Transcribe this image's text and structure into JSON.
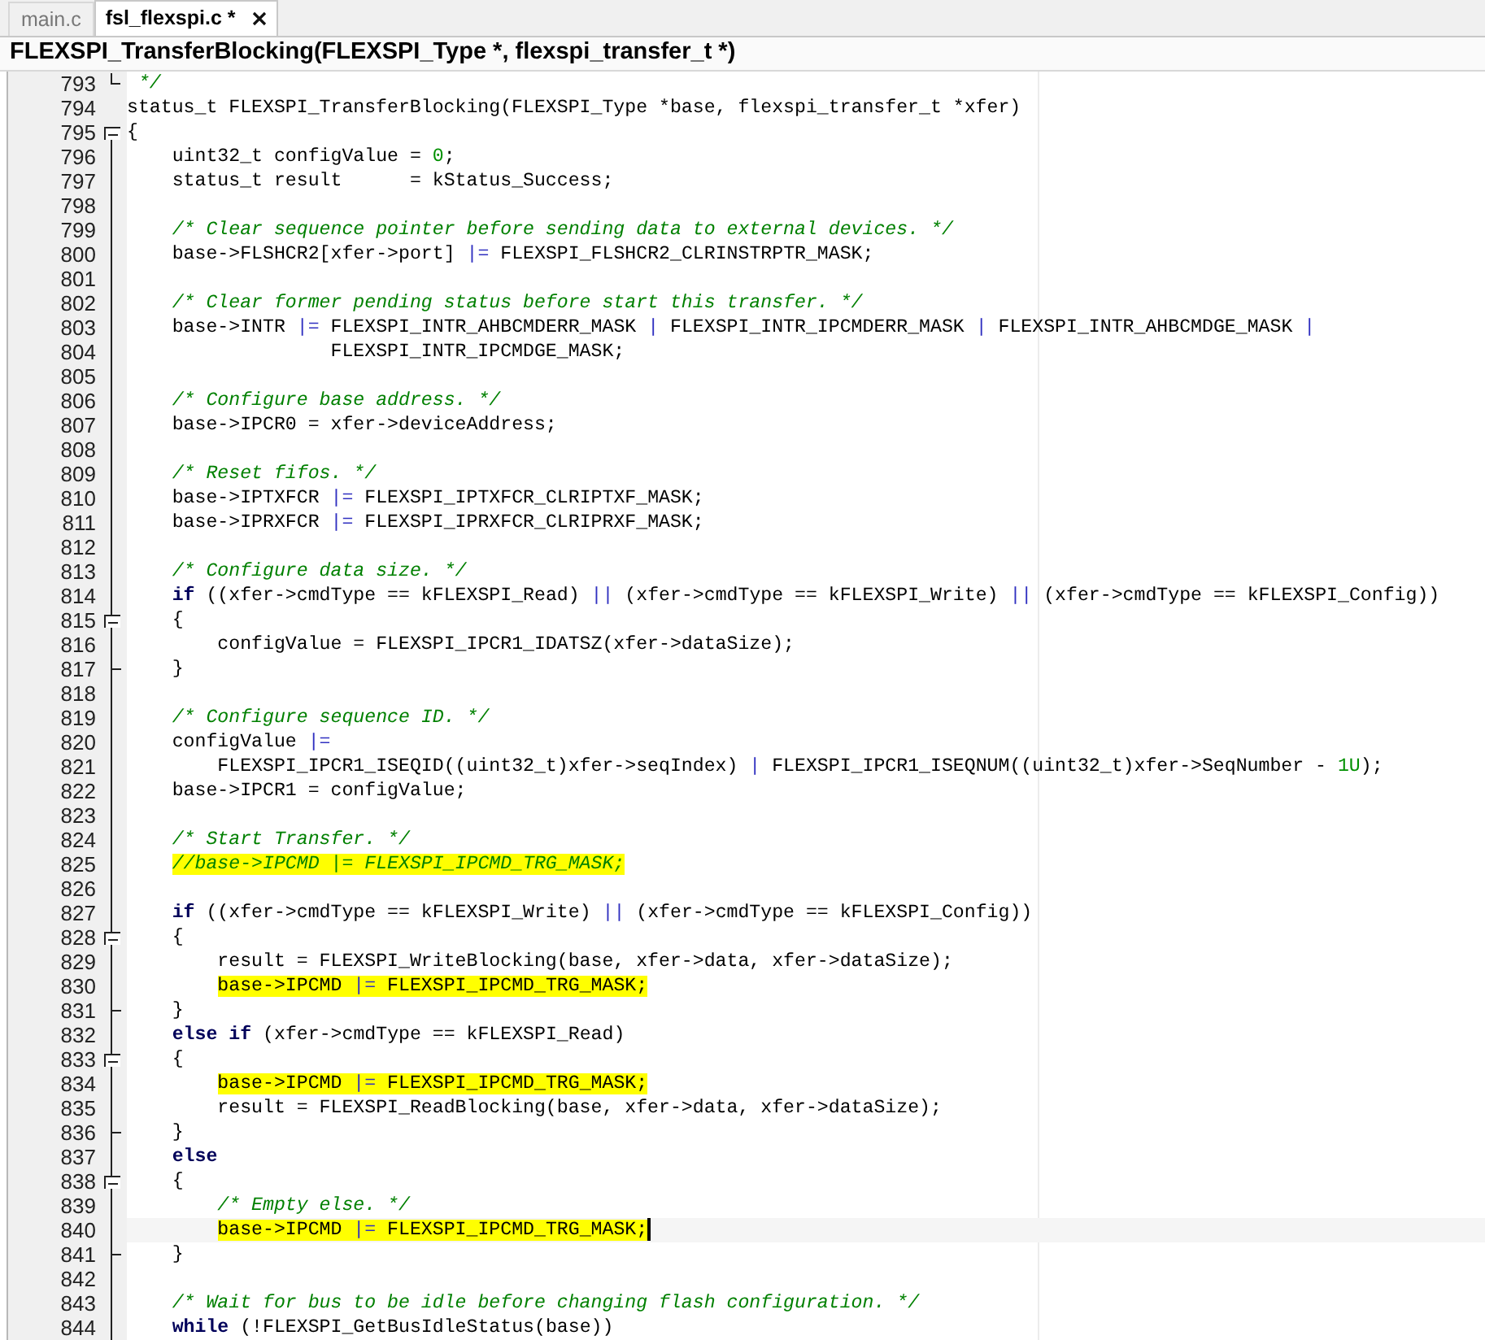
{
  "tabs": [
    {
      "label": "main.c",
      "selected": false,
      "closable": false
    },
    {
      "label": "fsl_flexspi.c *",
      "selected": true,
      "closable": true
    }
  ],
  "function_bar": {
    "title": "FLEXSPI_TransferBlocking(FLEXSPI_Type *, flexspi_transfer_t *)"
  },
  "lines": [
    {
      "n": "793",
      "kind": "comment",
      "text": " */",
      "fold_end": true
    },
    {
      "n": "794",
      "kind": "code",
      "text": "status_t FLEXSPI_TransferBlocking(FLEXSPI_Type *base, flexspi_transfer_t *xfer)"
    },
    {
      "n": "795",
      "kind": "code",
      "text": "{",
      "fold_open": true
    },
    {
      "n": "796",
      "kind": "code",
      "text": "    uint32_t configValue = 0;"
    },
    {
      "n": "797",
      "kind": "code",
      "text": "    status_t result      = kStatus_Success;"
    },
    {
      "n": "798"
    },
    {
      "n": "799",
      "kind": "comment",
      "text": "    /* Clear sequence pointer before sending data to external devices. */"
    },
    {
      "n": "800",
      "kind": "code",
      "text": "    base->FLSHCR2[xfer->port] |= FLEXSPI_FLSHCR2_CLRINSTRPTR_MASK;"
    },
    {
      "n": "801"
    },
    {
      "n": "802",
      "kind": "comment",
      "text": "    /* Clear former pending status before start this transfer. */"
    },
    {
      "n": "803",
      "kind": "code",
      "text": "    base->INTR |= FLEXSPI_INTR_AHBCMDERR_MASK | FLEXSPI_INTR_IPCMDERR_MASK | FLEXSPI_INTR_AHBCMDGE_MASK |"
    },
    {
      "n": "804",
      "kind": "code",
      "text": "                  FLEXSPI_INTR_IPCMDGE_MASK;"
    },
    {
      "n": "805"
    },
    {
      "n": "806",
      "kind": "comment",
      "text": "    /* Configure base address. */"
    },
    {
      "n": "807",
      "kind": "code",
      "text": "    base->IPCR0 = xfer->deviceAddress;"
    },
    {
      "n": "808"
    },
    {
      "n": "809",
      "kind": "comment",
      "text": "    /* Reset fifos. */"
    },
    {
      "n": "810",
      "kind": "code",
      "text": "    base->IPTXFCR |= FLEXSPI_IPTXFCR_CLRIPTXF_MASK;"
    },
    {
      "n": "811",
      "kind": "code",
      "text": "    base->IPRXFCR |= FLEXSPI_IPRXFCR_CLRIPRXF_MASK;"
    },
    {
      "n": "812"
    },
    {
      "n": "813",
      "kind": "comment",
      "text": "    /* Configure data size. */"
    },
    {
      "n": "814",
      "kind": "code",
      "text": "    if ((xfer->cmdType == kFLEXSPI_Read) || (xfer->cmdType == kFLEXSPI_Write) || (xfer->cmdType == kFLEXSPI_Config))"
    },
    {
      "n": "815",
      "kind": "code",
      "text": "    {",
      "fold_open": true
    },
    {
      "n": "816",
      "kind": "code",
      "text": "        configValue = FLEXSPI_IPCR1_IDATSZ(xfer->dataSize);"
    },
    {
      "n": "817",
      "kind": "code",
      "text": "    }",
      "fold_end": true
    },
    {
      "n": "818"
    },
    {
      "n": "819",
      "kind": "comment",
      "text": "    /* Configure sequence ID. */"
    },
    {
      "n": "820",
      "kind": "code",
      "text": "    configValue |="
    },
    {
      "n": "821",
      "kind": "code",
      "text": "        FLEXSPI_IPCR1_ISEQID((uint32_t)xfer->seqIndex) | FLEXSPI_IPCR1_ISEQNUM((uint32_t)xfer->SeqNumber - 1U);"
    },
    {
      "n": "822",
      "kind": "code",
      "text": "    base->IPCR1 = configValue;"
    },
    {
      "n": "823"
    },
    {
      "n": "824",
      "kind": "comment",
      "text": "    /* Start Transfer. */"
    },
    {
      "n": "825",
      "kind": "comment",
      "text": "    //base->IPCMD |= FLEXSPI_IPCMD_TRG_MASK;",
      "highlighted": true
    },
    {
      "n": "826"
    },
    {
      "n": "827",
      "kind": "code",
      "text": "    if ((xfer->cmdType == kFLEXSPI_Write) || (xfer->cmdType == kFLEXSPI_Config))"
    },
    {
      "n": "828",
      "kind": "code",
      "text": "    {",
      "fold_open": true
    },
    {
      "n": "829",
      "kind": "code",
      "text": "        result = FLEXSPI_WriteBlocking(base, xfer->data, xfer->dataSize);"
    },
    {
      "n": "830",
      "kind": "code",
      "text": "        base->IPCMD |= FLEXSPI_IPCMD_TRG_MASK;",
      "highlighted": true
    },
    {
      "n": "831",
      "kind": "code",
      "text": "    }",
      "fold_end": true
    },
    {
      "n": "832",
      "kind": "code",
      "text": "    else if (xfer->cmdType == kFLEXSPI_Read)"
    },
    {
      "n": "833",
      "kind": "code",
      "text": "    {",
      "fold_open": true
    },
    {
      "n": "834",
      "kind": "code",
      "text": "        base->IPCMD |= FLEXSPI_IPCMD_TRG_MASK;",
      "highlighted": true
    },
    {
      "n": "835",
      "kind": "code",
      "text": "        result = FLEXSPI_ReadBlocking(base, xfer->data, xfer->dataSize);"
    },
    {
      "n": "836",
      "kind": "code",
      "text": "    }",
      "fold_end": true
    },
    {
      "n": "837",
      "kind": "code",
      "text": "    else"
    },
    {
      "n": "838",
      "kind": "code",
      "text": "    {",
      "fold_open": true
    },
    {
      "n": "839",
      "kind": "comment",
      "text": "        /* Empty else. */"
    },
    {
      "n": "840",
      "kind": "code",
      "text": "        base->IPCMD |= FLEXSPI_IPCMD_TRG_MASK;",
      "highlighted": true,
      "current": true
    },
    {
      "n": "841",
      "kind": "code",
      "text": "    }",
      "fold_end": true
    },
    {
      "n": "842"
    },
    {
      "n": "843",
      "kind": "comment",
      "text": "    /* Wait for bus to be idle before changing flash configuration. */"
    },
    {
      "n": "844",
      "kind": "code",
      "text": "    while (!FLEXSPI_GetBusIdleStatus(base))"
    }
  ]
}
